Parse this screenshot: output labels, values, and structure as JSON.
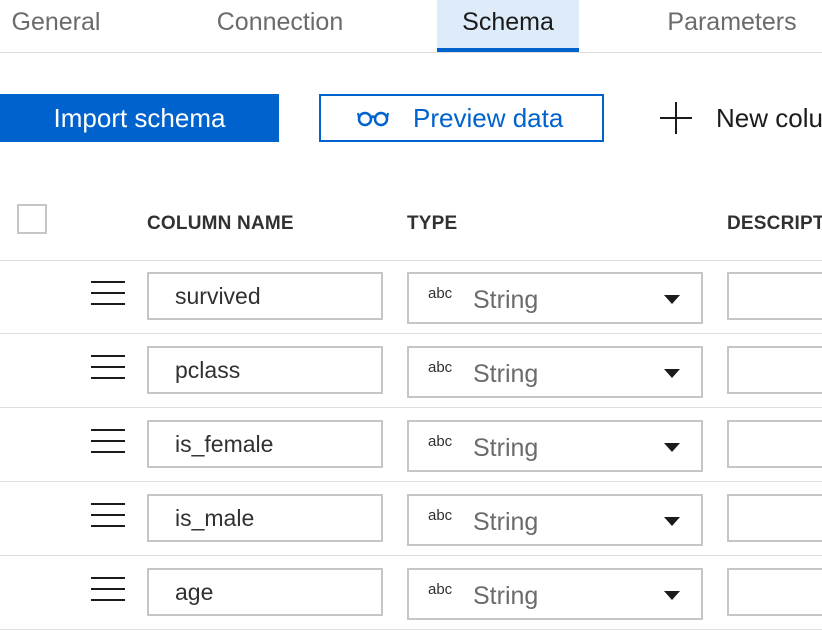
{
  "tabs": [
    {
      "label": "General",
      "active": false
    },
    {
      "label": "Connection",
      "active": false
    },
    {
      "label": "Schema",
      "active": true
    },
    {
      "label": "Parameters",
      "active": false
    }
  ],
  "toolbar": {
    "import_label": "Import schema",
    "preview_label": "Preview data",
    "preview_icon": "glasses-icon",
    "new_column_label": "New colu",
    "new_column_icon": "plus-icon"
  },
  "table": {
    "headers": {
      "column_name": "COLUMN NAME",
      "type": "TYPE",
      "description": "DESCRIPTI"
    },
    "rows": [
      {
        "name": "survived",
        "type_abbr": "abc",
        "type": "String"
      },
      {
        "name": "pclass",
        "type_abbr": "abc",
        "type": "String"
      },
      {
        "name": "is_female",
        "type_abbr": "abc",
        "type": "String"
      },
      {
        "name": "is_male",
        "type_abbr": "abc",
        "type": "String"
      },
      {
        "name": "age",
        "type_abbr": "abc",
        "type": "String"
      }
    ]
  },
  "colors": {
    "accent": "#0062cc",
    "active_tab_bg": "#deecf9",
    "border": "#c8c6c4"
  }
}
